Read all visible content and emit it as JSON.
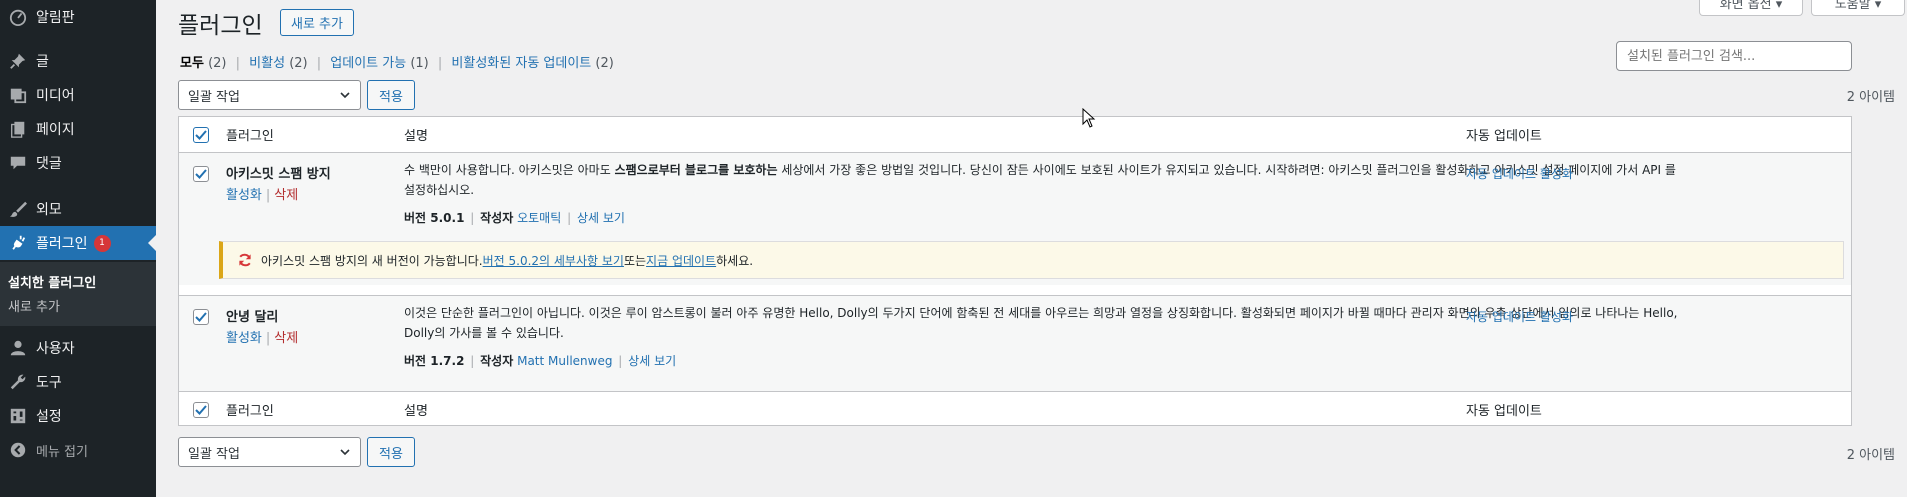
{
  "sidebar": {
    "items": [
      {
        "label": "알림판",
        "icon": "dashboard-icon"
      },
      {
        "label": "글",
        "icon": "pin-icon"
      },
      {
        "label": "미디어",
        "icon": "media-icon"
      },
      {
        "label": "페이지",
        "icon": "page-icon"
      },
      {
        "label": "댓글",
        "icon": "comment-icon"
      },
      {
        "label": "외모",
        "icon": "brush-icon"
      },
      {
        "label": "플러그인",
        "icon": "plugin-icon",
        "badge": "1"
      },
      {
        "label": "사용자",
        "icon": "user-icon"
      },
      {
        "label": "도구",
        "icon": "wrench-icon"
      },
      {
        "label": "설정",
        "icon": "settings-icon"
      }
    ],
    "submenu": [
      "설치한 플러그인",
      "새로 추가"
    ],
    "collapse_label": "메뉴 접기"
  },
  "header": {
    "title": "플러그인",
    "add_new": "새로 추가",
    "screen_options": "화면 옵션 ▾",
    "help": "도움말 ▾"
  },
  "filters": {
    "all": "모두",
    "all_count": "(2)",
    "inactive": "비활성",
    "inactive_count": "(2)",
    "updates": "업데이트 가능",
    "updates_count": "(1)",
    "auto_disabled": "비활성화된 자동 업데이트",
    "auto_disabled_count": "(2)"
  },
  "search": {
    "placeholder": "설치된 플러그인 검색..."
  },
  "bulk": {
    "label": "일괄 작업",
    "apply": "적용",
    "count": "2 아이템"
  },
  "table": {
    "col_plugin": "플러그인",
    "col_desc": "설명",
    "col_auto": "자동 업데이트",
    "rows": [
      {
        "name": "아키스밋 스팸 방지",
        "activate": "활성화",
        "delete": "삭제",
        "desc_a": "수 백만이 사용합니다. 아키스밋은 아마도 ",
        "desc_bold": "스팸으로부터 블로그를 보호하는",
        "desc_b": " 세상에서 가장 좋은 방법일 것입니다. 당신이 잠든 사이에도 보호된 사이트가 유지되고 있습니다. 시작하려면: 아키스밋 플러그인을 활성화하고 아키스밋 설정 페이지에 가서 API 를 설정하십시오.",
        "version": "버전 5.0.1",
        "author_label": "작성자",
        "author": "오토매틱",
        "details": "상세 보기",
        "auto": "자동 업데이트 활성화"
      },
      {
        "name": "안녕 달리",
        "activate": "활성화",
        "delete": "삭제",
        "desc_a": "이것은 단순한 플러그인이 아닙니다. 이것은 루이 암스트롱이 불러 아주 유명한 Hello, Dolly의 두가지 단어에 함축된 전 세대를 아우르는 희망과 열정을 상징화합니다. 활성화되면 페이지가 바뀔 때마다 관리자 화면의 우측 상단에서 임의로 나타나는 Hello, Dolly의 가사를 볼 수 있습니다.",
        "version": "버전 1.7.2",
        "author_label": "작성자",
        "author": "Matt Mullenweg",
        "details": "상세 보기",
        "auto": "자동 업데이트 활성화"
      }
    ]
  },
  "notice": {
    "text_a": "아키스밋 스팸 방지의 새 버전이 가능합니다. ",
    "link1": "버전 5.0.2의 세부사항 보기",
    "text_b": " 또는 ",
    "link2": "지금 업데이트",
    "text_c": "하세요."
  }
}
